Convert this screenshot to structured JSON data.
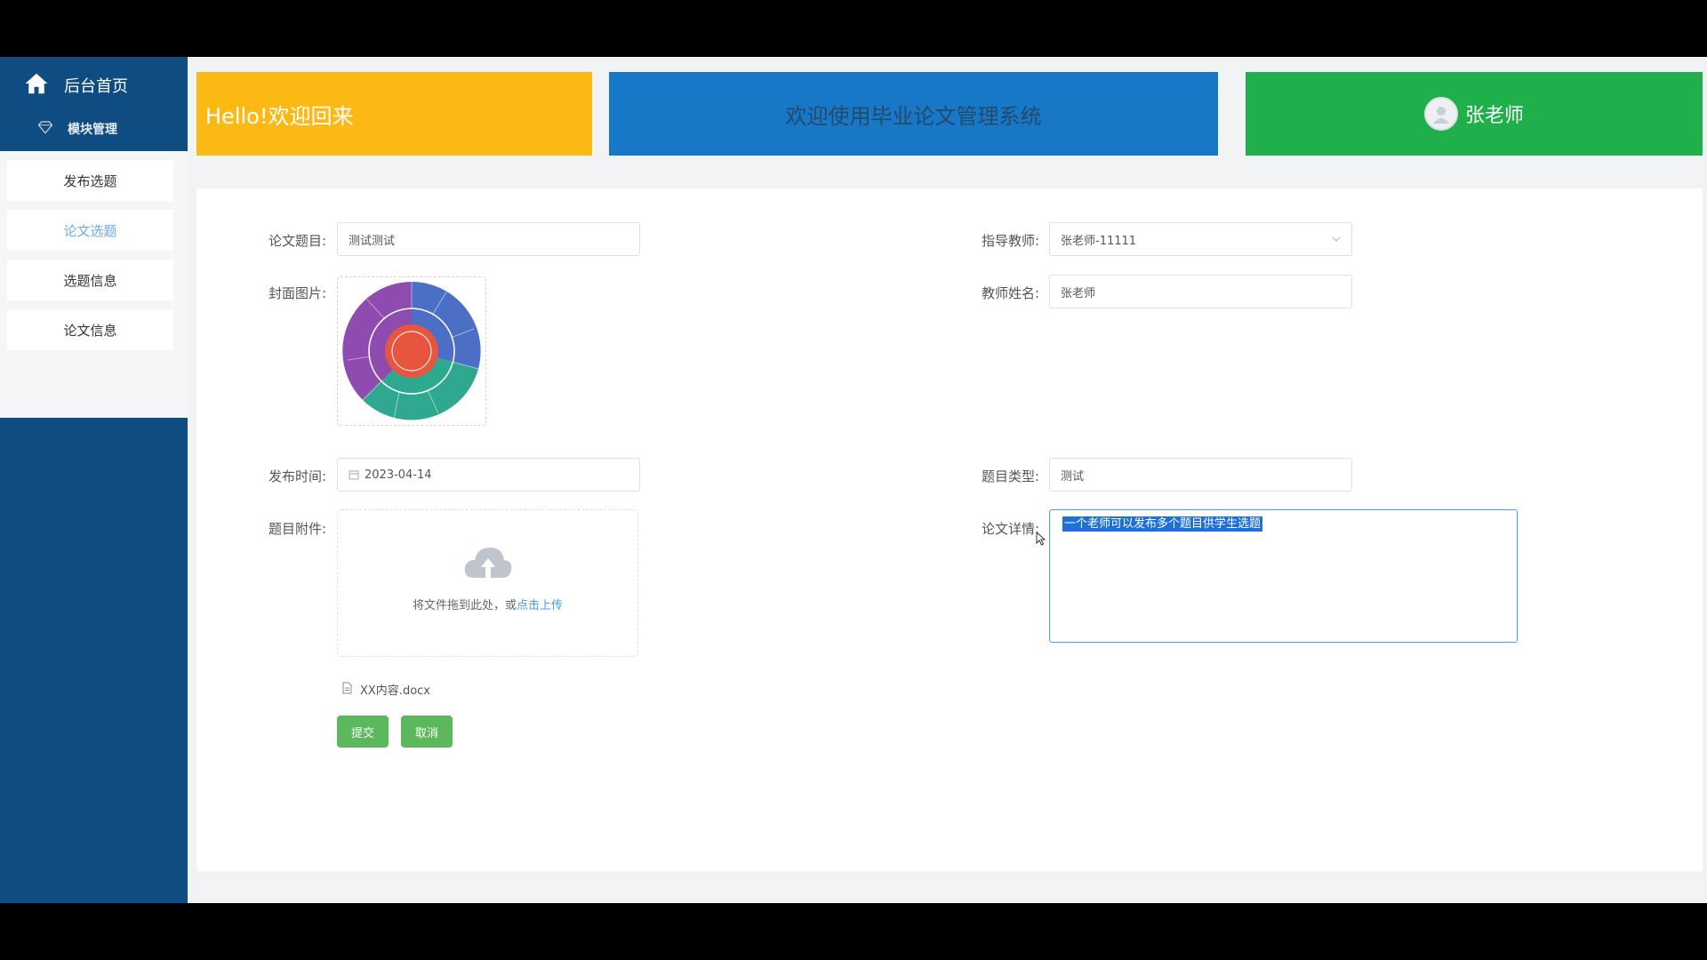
{
  "sidebar": {
    "home_label": "后台首页",
    "module_label": "模块管理",
    "items": [
      {
        "label": "发布选题"
      },
      {
        "label": "论文选题"
      },
      {
        "label": "选题信息"
      },
      {
        "label": "论文信息"
      }
    ],
    "active_index": 1
  },
  "banners": {
    "hello": "Hello!欢迎回来",
    "welcome": "欢迎使用毕业论文管理系统",
    "teacher_name": "张老师"
  },
  "form": {
    "title_label": "论文题目:",
    "title_value": "测试测试",
    "cover_label": "封面图片:",
    "publish_time_label": "发布时间:",
    "publish_time_value": "2023-04-14",
    "attachment_label": "题目附件:",
    "upload_hint": "将文件拖到此处，或",
    "upload_link": "点击上传",
    "file_name": "XX内容.docx",
    "submit_label": "提交",
    "cancel_label": "取消",
    "advisor_label": "指导教师:",
    "advisor_value": "张老师-11111",
    "teacher_name_label": "教师姓名:",
    "teacher_name_value": "张老师",
    "topic_type_label": "题目类型:",
    "topic_type_value": "测试",
    "details_label": "论文详情:",
    "details_value": "一个老师可以发布多个题目供学生选题"
  },
  "colors": {
    "sidebar": "#0f4c81",
    "banner_yellow": "#fcb813",
    "banner_blue": "#1778c8",
    "banner_green": "#20b04b",
    "button_green": "#5cb85c",
    "accent_blue": "#409eff"
  }
}
